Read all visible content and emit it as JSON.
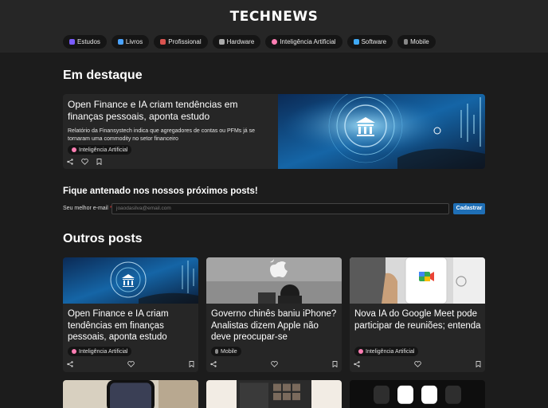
{
  "header": {
    "logo": "TECHNEWS",
    "categories": [
      {
        "label": "Estudos",
        "icon": "books-icon",
        "color": "#7a5cff"
      },
      {
        "label": "Livros",
        "icon": "book-stack-icon",
        "color": "#4aa3ff"
      },
      {
        "label": "Profissional",
        "icon": "briefcase-icon",
        "color": "#d9534f"
      },
      {
        "label": "Hardware",
        "icon": "keyboard-icon",
        "color": "#aaaaaa"
      },
      {
        "label": "Inteligência Artificial",
        "icon": "brain-icon",
        "color": "#ff7eb3"
      },
      {
        "label": "Software",
        "icon": "monitor-icon",
        "color": "#3fa9f5"
      },
      {
        "label": "Mobile",
        "icon": "phone-icon",
        "color": "#888888"
      }
    ]
  },
  "featured": {
    "section_title": "Em destaque",
    "title": "Open Finance e IA criam tendências em finanças pessoais, aponta estudo",
    "description": "Relatório da Finansystech indica que agregadores de contas ou PFMs já se tornaram uma commodity no setor financeiro",
    "tag": "Inteligência Artificial"
  },
  "newsletter": {
    "title": "Fique antenado nos nossos próximos posts!",
    "label": "Seu melhor e-mail",
    "required_mark": "*",
    "placeholder": "joaodasilva@email.com",
    "button": "Cadastrar"
  },
  "others": {
    "section_title": "Outros posts",
    "posts": [
      {
        "title": "Open Finance e IA criam tendências em finanças pessoais, aponta estudo",
        "tag": "Inteligência Artificial"
      },
      {
        "title": "Governo chinês baniu iPhone? Analistas dizem Apple não deve preocupar-se",
        "tag": "Mobile"
      },
      {
        "title": "Nova IA do Google Meet pode participar de reuniões; entenda",
        "tag": "Inteligência Artificial"
      }
    ]
  },
  "colors": {
    "accent": "#1f6fb6",
    "card": "#262626",
    "background": "#1c1c1c"
  }
}
